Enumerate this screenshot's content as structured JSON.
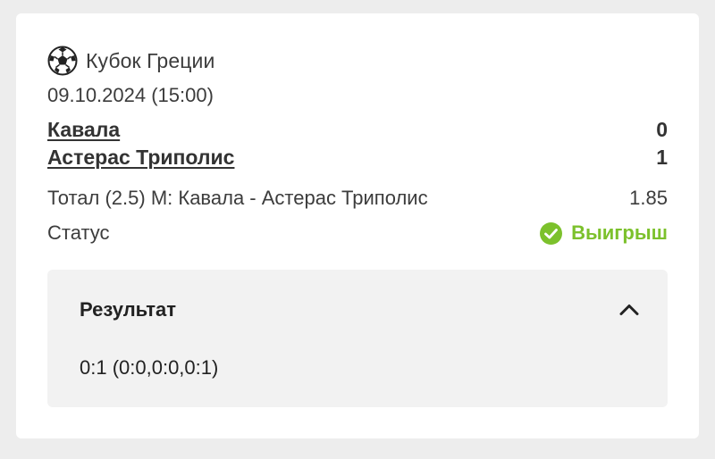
{
  "league": {
    "icon": "soccer-ball-icon",
    "name": "Кубок Греции"
  },
  "match": {
    "datetime": "09.10.2024 (15:00)",
    "home_team": "Кавала",
    "home_score": "0",
    "away_team": "Астерас Триполис",
    "away_score": "1"
  },
  "bet": {
    "selection": "Тотал (2.5) М: Кавала - Астерас Триполис",
    "odds": "1.85"
  },
  "status": {
    "label": "Статус",
    "value": "Выигрыш",
    "icon": "check-circle-icon",
    "color": "#7cc12c"
  },
  "result": {
    "title": "Результат",
    "score": "0:1 (0:0,0:0,0:1)",
    "expanded": true
  }
}
